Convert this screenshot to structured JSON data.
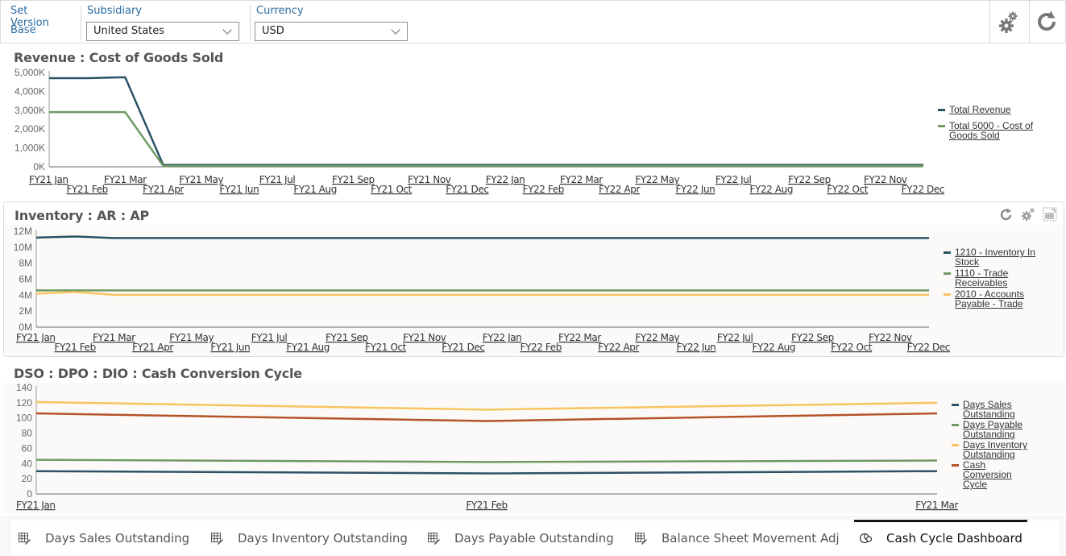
{
  "filters": {
    "set_version": {
      "label": "Set Version",
      "value": "Base"
    },
    "subsidiary": {
      "label": "Subsidiary",
      "value": "United States"
    },
    "currency": {
      "label": "Currency",
      "value": "USD"
    }
  },
  "toolbar": {
    "settings_icon": "gears-icon",
    "refresh_icon": "refresh-icon"
  },
  "panels": {
    "revenue": {
      "title": "Revenue : Cost of Goods Sold"
    },
    "inventory": {
      "title": "Inventory : AR : AP"
    },
    "dso": {
      "title": "DSO : DPO : DIO : Cash Conversion Cycle"
    }
  },
  "chart_data": [
    {
      "type": "line",
      "title": "Revenue : Cost of Goods Sold",
      "xlabel": "",
      "ylabel": "",
      "ylim": [
        0,
        5000
      ],
      "y_ticks": [
        "0K",
        "1,000K",
        "2,000K",
        "3,000K",
        "4,000K",
        "5,000K"
      ],
      "y_tick_values": [
        0,
        1000,
        2000,
        3000,
        4000,
        5000
      ],
      "categories": [
        "FY21 Jan",
        "FY21 Feb",
        "FY21 Mar",
        "FY21 Apr",
        "FY21 May",
        "FY21 Jun",
        "FY21 Jul",
        "FY21 Aug",
        "FY21 Sep",
        "FY21 Oct",
        "FY21 Nov",
        "FY21 Dec",
        "FY22 Jan",
        "FY22 Feb",
        "FY22 Mar",
        "FY22 Apr",
        "FY22 May",
        "FY22 Jun",
        "FY22 Jul",
        "FY22 Aug",
        "FY22 Sep",
        "FY22 Oct",
        "FY22 Nov",
        "FY22 Dec"
      ],
      "series": [
        {
          "name": "Total Revenue",
          "color": "#2c5266",
          "values": [
            4700,
            4700,
            4750,
            100,
            100,
            100,
            100,
            100,
            100,
            100,
            100,
            100,
            100,
            100,
            100,
            100,
            100,
            100,
            100,
            100,
            100,
            100,
            100,
            100
          ]
        },
        {
          "name": "Total 5000 - Cost of Goods Sold",
          "color": "#6f9a63",
          "values": [
            2900,
            2900,
            2900,
            50,
            50,
            50,
            50,
            50,
            50,
            50,
            50,
            50,
            50,
            50,
            50,
            50,
            50,
            50,
            50,
            50,
            50,
            50,
            50,
            50
          ]
        }
      ],
      "legend": "right",
      "grid": false
    },
    {
      "type": "line",
      "title": "Inventory : AR : AP",
      "ylim": [
        0,
        12
      ],
      "y_ticks": [
        "0M",
        "2M",
        "4M",
        "6M",
        "8M",
        "10M",
        "12M"
      ],
      "y_tick_values": [
        0,
        2,
        4,
        6,
        8,
        10,
        12
      ],
      "categories": [
        "FY21 Jan",
        "FY21 Feb",
        "FY21 Mar",
        "FY21 Apr",
        "FY21 May",
        "FY21 Jun",
        "FY21 Jul",
        "FY21 Aug",
        "FY21 Sep",
        "FY21 Oct",
        "FY21 Nov",
        "FY21 Dec",
        "FY22 Jan",
        "FY22 Feb",
        "FY22 Mar",
        "FY22 Apr",
        "FY22 May",
        "FY22 Jun",
        "FY22 Jul",
        "FY22 Aug",
        "FY22 Sep",
        "FY22 Oct",
        "FY22 Nov",
        "FY22 Dec"
      ],
      "series": [
        {
          "name": "1210 - Inventory In Stock",
          "color": "#2c5266",
          "values": [
            11.2,
            11.35,
            11.15,
            11.15,
            11.15,
            11.15,
            11.15,
            11.15,
            11.15,
            11.15,
            11.15,
            11.15,
            11.15,
            11.15,
            11.15,
            11.15,
            11.15,
            11.15,
            11.15,
            11.15,
            11.15,
            11.15,
            11.15,
            11.15
          ]
        },
        {
          "name": "1110 - Trade Receivables",
          "color": "#6f9a63",
          "values": [
            4.6,
            4.6,
            4.6,
            4.6,
            4.6,
            4.6,
            4.6,
            4.6,
            4.6,
            4.6,
            4.6,
            4.6,
            4.6,
            4.6,
            4.6,
            4.6,
            4.6,
            4.6,
            4.6,
            4.6,
            4.6,
            4.6,
            4.6,
            4.6
          ]
        },
        {
          "name": "2010 - Accounts Payable - Trade",
          "color": "#f7c55f",
          "values": [
            4.2,
            4.4,
            4.05,
            4.05,
            4.05,
            4.05,
            4.05,
            4.05,
            4.05,
            4.05,
            4.05,
            4.05,
            4.05,
            4.05,
            4.05,
            4.05,
            4.05,
            4.05,
            4.05,
            4.05,
            4.05,
            4.05,
            4.05,
            4.05
          ]
        }
      ],
      "legend": "right",
      "grid": false
    },
    {
      "type": "line",
      "title": "DSO : DPO : DIO : Cash Conversion Cycle",
      "ylim": [
        0,
        140
      ],
      "y_ticks": [
        "0",
        "20",
        "40",
        "60",
        "80",
        "100",
        "120",
        "140"
      ],
      "y_tick_values": [
        0,
        20,
        40,
        60,
        80,
        100,
        120,
        140
      ],
      "categories": [
        "FY21 Jan",
        "FY21 Feb",
        "FY21 Mar"
      ],
      "series": [
        {
          "name": "Days Sales Outstanding",
          "color": "#2c5266",
          "values": [
            30,
            27,
            30
          ]
        },
        {
          "name": "Days Payable Outstanding",
          "color": "#6f9a63",
          "values": [
            45,
            42,
            44
          ]
        },
        {
          "name": "Days Inventory Outstanding",
          "color": "#f7c55f",
          "values": [
            121,
            111,
            120
          ]
        },
        {
          "name": "Cash Conversion Cycle",
          "color": "#b4532a",
          "values": [
            106,
            96,
            106
          ]
        }
      ],
      "legend": "right",
      "grid": false
    }
  ],
  "tabs": [
    {
      "label": "Days Sales Outstanding",
      "icon": "edit-grid-icon",
      "active": false
    },
    {
      "label": "Days Inventory Outstanding",
      "icon": "edit-grid-icon",
      "active": false
    },
    {
      "label": "Days Payable Outstanding",
      "icon": "edit-grid-icon",
      "active": false
    },
    {
      "label": "Balance Sheet Movement Adj",
      "icon": "edit-grid-icon",
      "active": false
    },
    {
      "label": "Cash Cycle Dashboard",
      "icon": "dashboard-icon",
      "active": true
    }
  ]
}
